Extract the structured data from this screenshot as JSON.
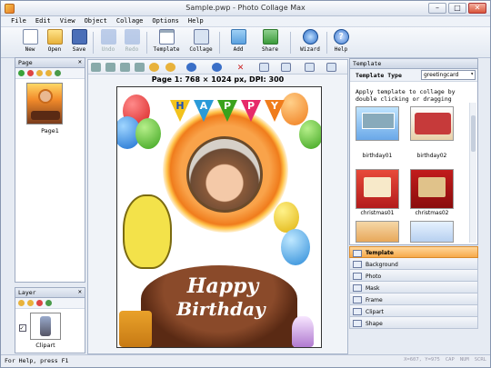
{
  "window": {
    "title": "Sample.pwp - Photo Collage Max"
  },
  "menu": [
    "File",
    "Edit",
    "View",
    "Object",
    "Collage",
    "Options",
    "Help"
  ],
  "toolbar": {
    "new": "New",
    "open": "Open",
    "save": "Save",
    "undo": "Undo",
    "redo": "Redo",
    "template": "Template",
    "collage": "Collage",
    "add": "Add",
    "share": "Share",
    "wizard": "Wizard",
    "help": "Help"
  },
  "page_panel": {
    "title": "Page",
    "items": [
      {
        "label": "Page1"
      }
    ]
  },
  "layer_panel": {
    "title": "Layer",
    "items": [
      {
        "label": "Clipart"
      }
    ]
  },
  "canvas": {
    "info": "Page 1: 768 × 1024 px, DPI: 300",
    "banner": [
      "H",
      "A",
      "P",
      "P",
      "Y"
    ],
    "cake_text_1": "Happy",
    "cake_text_2": "Birthday"
  },
  "template_panel": {
    "title": "Template",
    "type_label": "Template Type",
    "type_value": "greetingcard",
    "hint": "Apply template to collage by double clicking or dragging",
    "items": [
      {
        "label": "birthday01"
      },
      {
        "label": "birthday02"
      },
      {
        "label": "christmas01"
      },
      {
        "label": "christmas02"
      }
    ]
  },
  "right_tabs": [
    {
      "label": "Template",
      "active": true
    },
    {
      "label": "Background"
    },
    {
      "label": "Photo"
    },
    {
      "label": "Mask"
    },
    {
      "label": "Frame"
    },
    {
      "label": "Clipart"
    },
    {
      "label": "Shape"
    }
  ],
  "status": {
    "text": "For Help, press F1",
    "right": [
      "X=607, Y=975",
      "CAP",
      "NUM",
      "SCRL"
    ]
  },
  "colors": {
    "accent": "#f7a94a",
    "panel_border": "#9eabc2"
  }
}
